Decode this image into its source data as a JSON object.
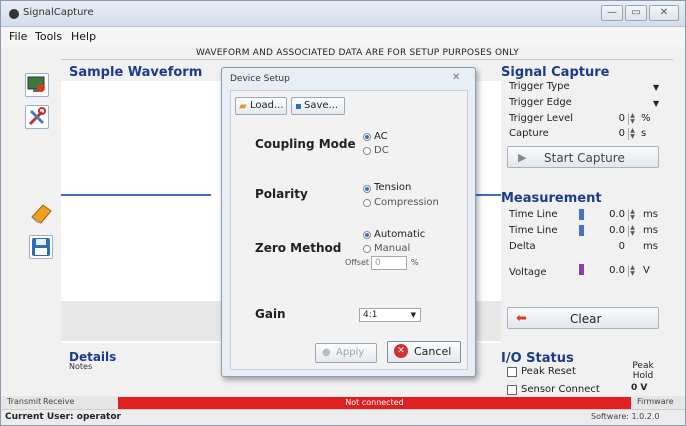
{
  "window": {
    "title": "SignalCapture",
    "min_glyph": "—",
    "max_glyph": "▭",
    "close_glyph": "✕"
  },
  "menu": {
    "items": [
      "File",
      "Tools",
      "Help"
    ]
  },
  "banner": "WAVEFORM AND ASSOCIATED DATA ARE FOR SETUP PURPOSES ONLY",
  "sample": {
    "title": "Sample Waveform"
  },
  "details": {
    "title": "Details",
    "notes_label": "Notes"
  },
  "signal_capture": {
    "title": "Signal Capture",
    "trigger_type_label": "Trigger Type",
    "trigger_edge_label": "Trigger Edge",
    "trigger_level_label": "Trigger Level",
    "trigger_level_value": "0",
    "trigger_level_unit": "%",
    "capture_label": "Capture",
    "capture_value": "0",
    "capture_unit": "s",
    "start_button": "Start Capture"
  },
  "measurement": {
    "title": "Measurement",
    "time_line_1_label": "Time Line",
    "time_line_1_value": "0.0",
    "time_line_1_unit": "ms",
    "time_line_2_label": "Time Line",
    "time_line_2_value": "0.0",
    "time_line_2_unit": "ms",
    "delta_label": "Delta",
    "delta_value": "0",
    "delta_unit": "ms",
    "voltage_label": "Voltage",
    "voltage_value": "0.0",
    "voltage_unit": "V",
    "clear_button": "Clear"
  },
  "io_status": {
    "title": "I/O Status",
    "peak_reset": "Peak Reset",
    "sensor_connect": "Sensor Connect",
    "peak_hold": "Peak Hold",
    "peak_hold_value": "0 V"
  },
  "status": {
    "transmit": "Transmit",
    "receive": "Receive",
    "connection": "Not connected",
    "firmware": "Firmware",
    "current_user": "Current User: operator",
    "software": "Software: 1.0.2.0"
  },
  "dialog": {
    "title": "Device Setup",
    "load_button": "Load...",
    "save_button": "Save...",
    "coupling_label": "Coupling Mode",
    "coupling_options": [
      "AC",
      "DC"
    ],
    "polarity_label": "Polarity",
    "polarity_options": [
      "Tension",
      "Compression"
    ],
    "zero_label": "Zero Method",
    "zero_options": [
      "Automatic",
      "Manual"
    ],
    "offset_label": "Offset",
    "offset_value": "0",
    "offset_unit": "%",
    "gain_label": "Gain",
    "gain_value": "4:1",
    "apply_button": "Apply",
    "cancel_button": "Cancel"
  },
  "colors": {
    "accent_blue": "#1c3b8c",
    "status_red": "#e02020",
    "cursor_blue": "#4473c5",
    "cursor_purple": "#8a3fb0"
  }
}
